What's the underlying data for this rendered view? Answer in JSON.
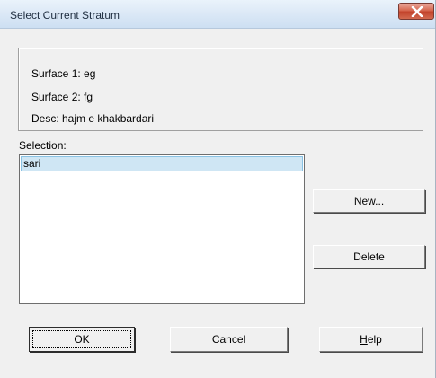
{
  "window": {
    "title": "Select Current Stratum",
    "close_icon": "close-icon"
  },
  "info": {
    "surface1": "Surface 1: eg",
    "surface2": "Surface 2: fg",
    "desc": "Desc: hajm e khakbardari"
  },
  "selection": {
    "label": "Selection:",
    "items": [
      "sari"
    ],
    "selected_index": 0
  },
  "buttons": {
    "new": "New...",
    "delete": "Delete",
    "ok": "OK",
    "cancel": "Cancel",
    "help_mnemonic": "H",
    "help_rest": "elp"
  },
  "colors": {
    "titlebar": "#dbe8f6",
    "close_button": "#c2432b",
    "selection_highlight": "#cfe6f4",
    "dialog_background": "#f0f0f0"
  }
}
